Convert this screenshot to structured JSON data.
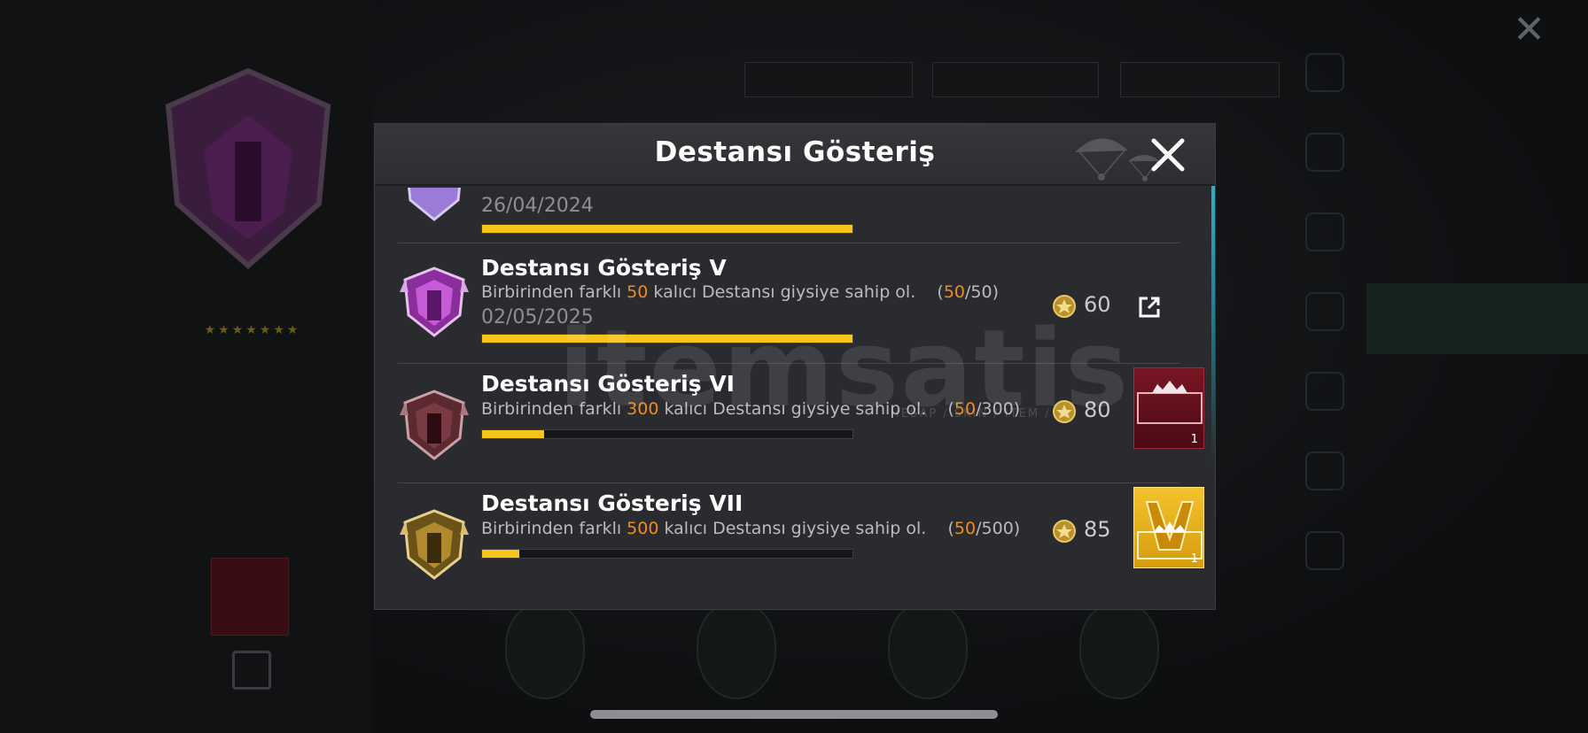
{
  "modal": {
    "title": "Destansı Gösteriş",
    "partial_row": {
      "date": "26/04/2024",
      "progress": 1.0
    },
    "rows": [
      {
        "title": "Destansı Gösteriş V",
        "desc_prefix": "Birbirinden farklı ",
        "desc_highlight": "50",
        "desc_suffix": " kalıcı Destansı giysiye sahip ol.",
        "progress_open": "(",
        "progress_current": "50",
        "progress_total": "/50)",
        "date": "02/05/2025",
        "progress": 1.0,
        "points": "60",
        "badge_color": "#c75ad6",
        "action": "share"
      },
      {
        "title": "Destansı Gösteriş VI",
        "desc_prefix": "Birbirinden farklı ",
        "desc_highlight": "300",
        "desc_suffix": " kalıcı Destansı giysiye sahip ol.",
        "progress_open": "(",
        "progress_current": "50",
        "progress_total": "/300)",
        "progress": 0.1667,
        "points": "80",
        "badge_color": "#7a3a44",
        "action": "reward",
        "reward_count": "1"
      },
      {
        "title": "Destansı Gösteriş VII",
        "desc_prefix": "Birbirinden farklı ",
        "desc_highlight": "500",
        "desc_suffix": " kalıcı Destansı giysiye sahip ol.",
        "progress_open": "(",
        "progress_current": "50",
        "progress_total": "/500)",
        "progress": 0.1,
        "points": "85",
        "badge_color": "#b08a2c",
        "action": "reward",
        "reward_count": "1"
      }
    ]
  },
  "watermark": {
    "text": "itemsatis",
    "subtext": "HESAP / SKIN / ITEM / ..."
  },
  "colors": {
    "accent_orange": "#f08c1e",
    "progress_yellow": "#f7c41a",
    "modal_bg": "#2a2b2e"
  }
}
